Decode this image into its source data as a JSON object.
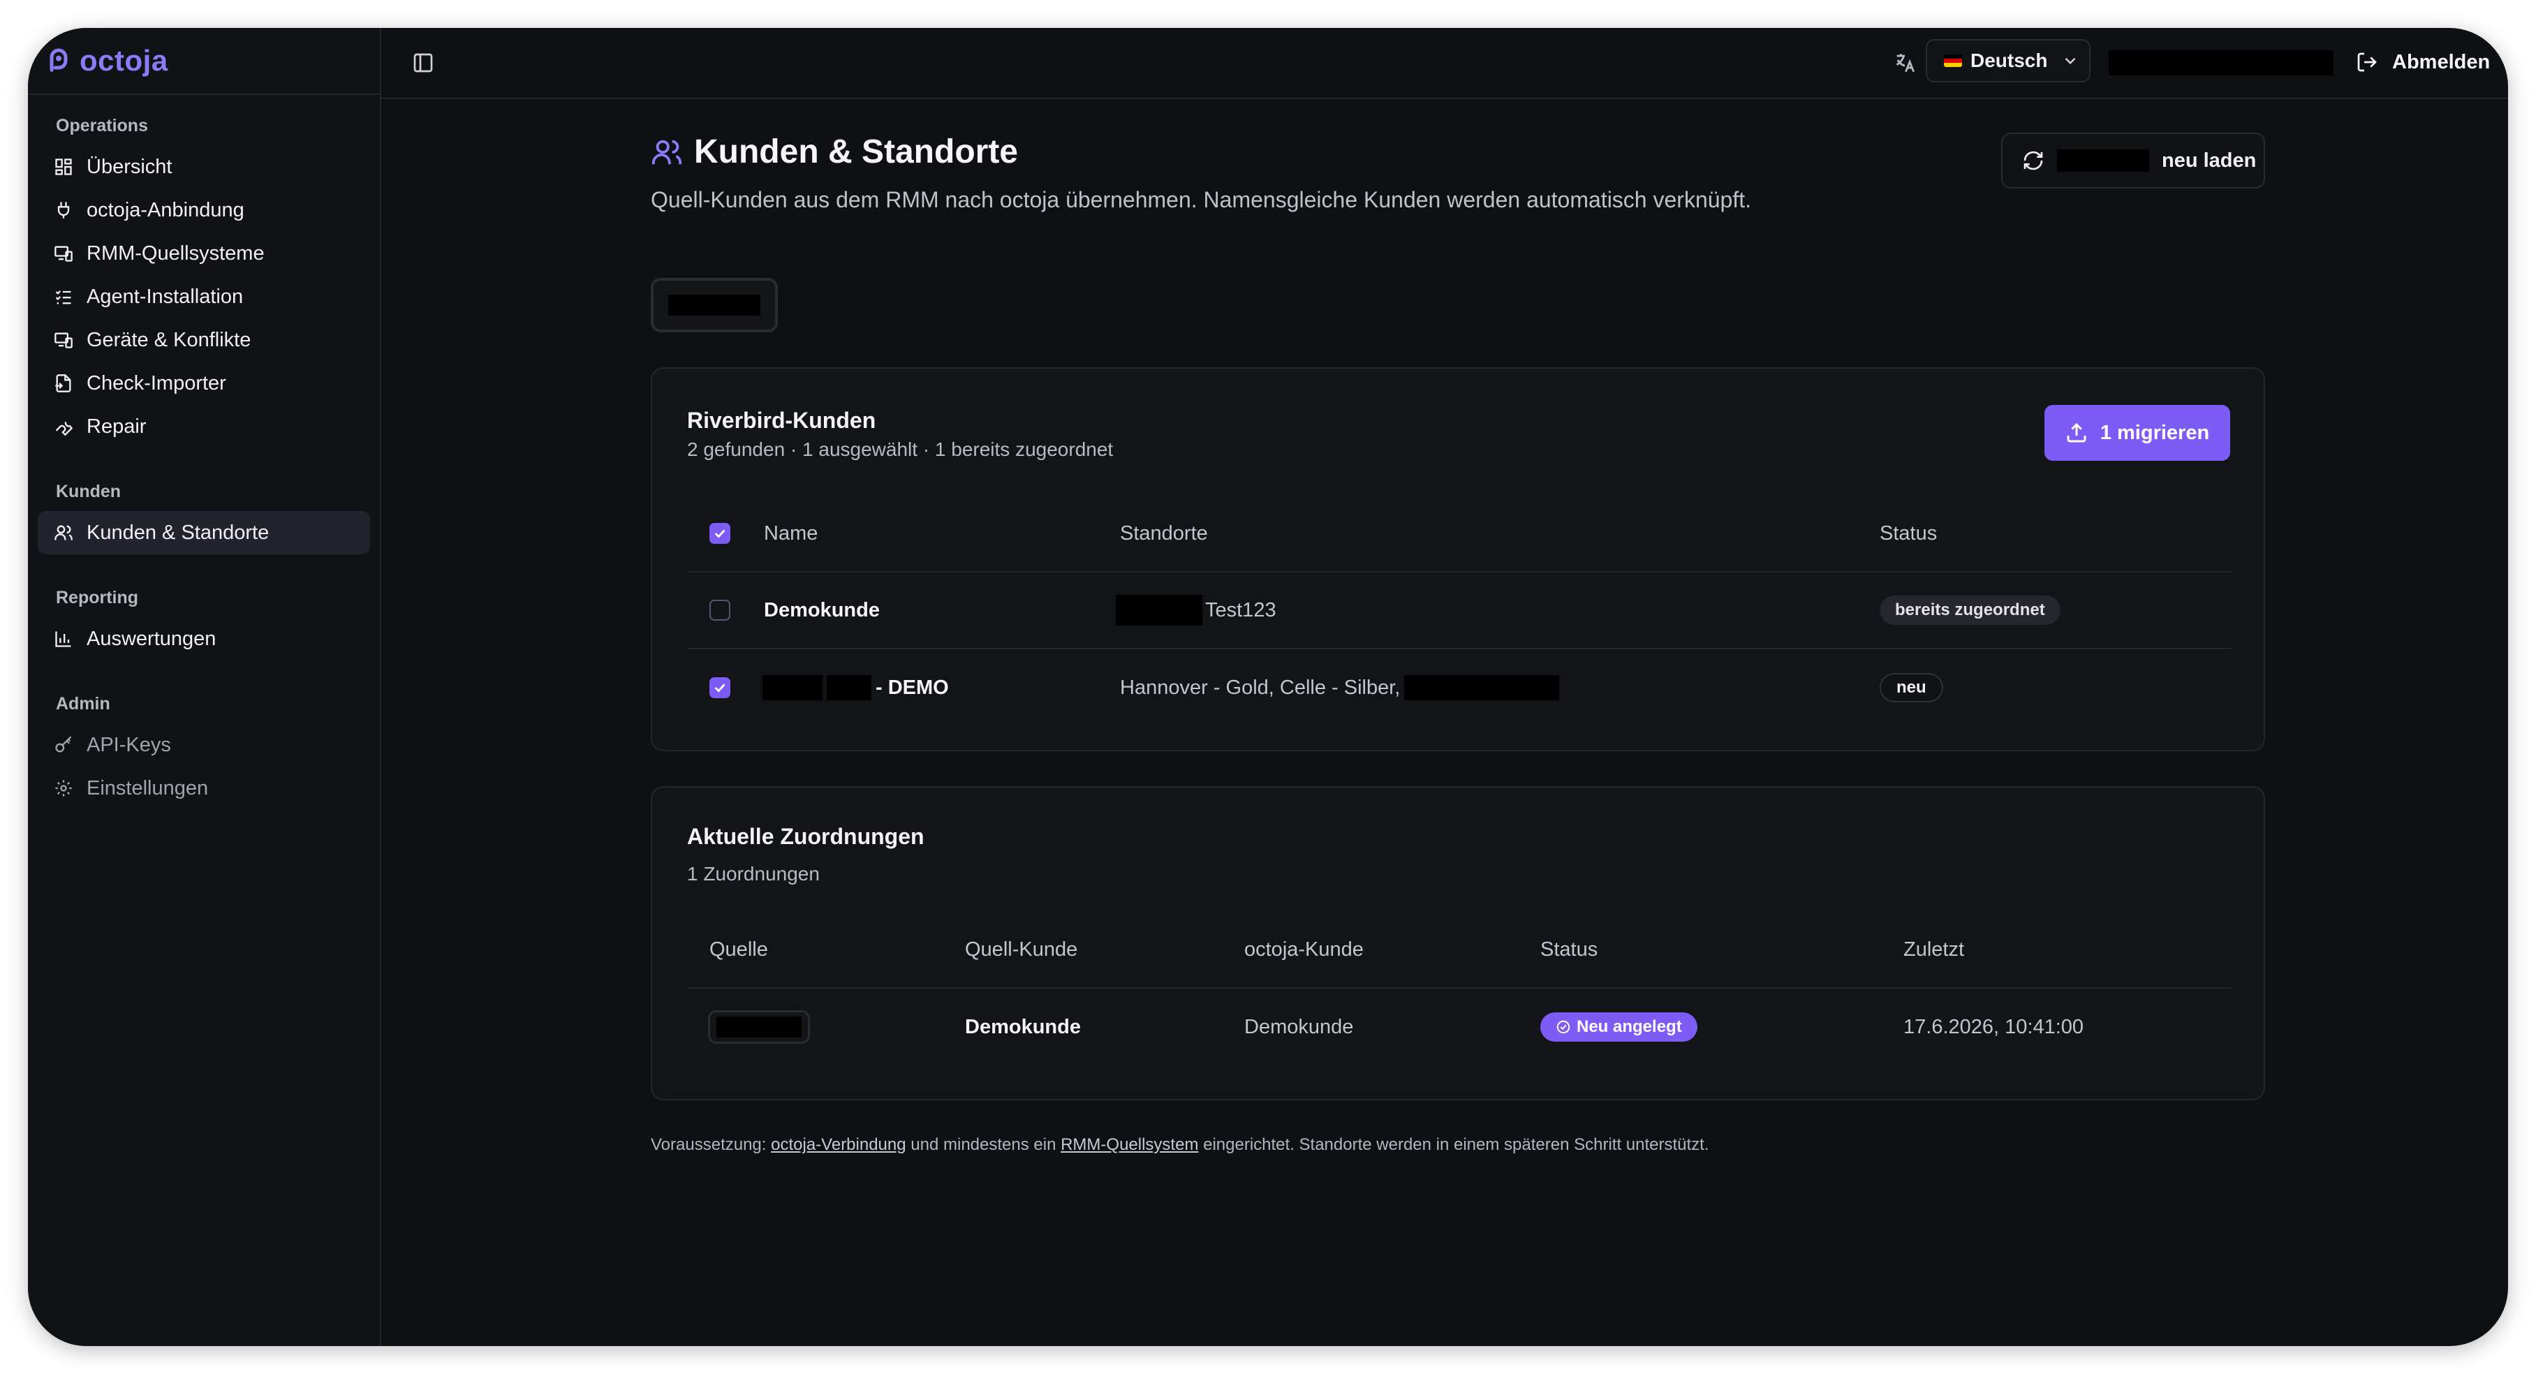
{
  "brand": {
    "name": "octoja"
  },
  "sidebar": {
    "sections": [
      {
        "label": "Operations",
        "items": [
          {
            "label": "Übersicht",
            "icon": "grid-icon"
          },
          {
            "label": "octoja-Anbindung",
            "icon": "plug-icon"
          },
          {
            "label": "RMM-Quellsysteme",
            "icon": "devices-icon"
          },
          {
            "label": "Agent-Installation",
            "icon": "list-check-icon"
          },
          {
            "label": "Geräte & Konflikte",
            "icon": "devices-icon"
          },
          {
            "label": "Check-Importer",
            "icon": "file-import-icon"
          },
          {
            "label": "Repair",
            "icon": "wrench-icon"
          }
        ]
      },
      {
        "label": "Kunden",
        "items": [
          {
            "label": "Kunden & Standorte",
            "icon": "users-icon",
            "active": true
          }
        ]
      },
      {
        "label": "Reporting",
        "items": [
          {
            "label": "Auswertungen",
            "icon": "bar-chart-icon"
          }
        ]
      },
      {
        "label": "Admin",
        "items": [
          {
            "label": "API-Keys",
            "icon": "key-icon",
            "muted": true
          },
          {
            "label": "Einstellungen",
            "icon": "gear-icon",
            "muted": true
          }
        ]
      }
    ]
  },
  "topbar": {
    "language": "Deutsch",
    "logout_label": "Abmelden"
  },
  "page": {
    "title": "Kunden & Standorte",
    "subtitle": "Quell-Kunden aus dem RMM nach octoja übernehmen. Namensgleiche Kunden werden automatisch verknüpft.",
    "reload_label": "neu laden"
  },
  "source_card": {
    "title": "Riverbird-Kunden",
    "summary": "2 gefunden · 1 ausgewählt · 1 bereits zugeordnet",
    "migrate_label": "1 migrieren",
    "columns": [
      "Name",
      "Standorte",
      "Status"
    ],
    "rows": [
      {
        "checked": false,
        "name": "Demokunde",
        "locations": "Test123",
        "status": "bereits zugeordnet"
      },
      {
        "checked": true,
        "name": "- DEMO",
        "locations": "Hannover - Gold, Celle - Silber,",
        "status": "neu"
      }
    ]
  },
  "mapping_card": {
    "title": "Aktuelle Zuordnungen",
    "summary": "1 Zuordnungen",
    "columns": [
      "Quelle",
      "Quell-Kunde",
      "octoja-Kunde",
      "Status",
      "Zuletzt"
    ],
    "rows": [
      {
        "source_customer": "Demokunde",
        "octoja_customer": "Demokunde",
        "status": "Neu angelegt",
        "last": "17.6.2026, 10:41:00"
      }
    ]
  },
  "footnote": {
    "prefix": "Voraussetzung:",
    "link1": "octoja-Verbindung",
    "middle": "und mindestens ein",
    "link2": "RMM-Quellsystem",
    "suffix": "eingerichtet. Standorte werden in einem späteren Schritt unterstützt."
  },
  "colors": {
    "accent": "#7c5cf4",
    "background": "#0f1013",
    "brand": "#8b7cf6"
  }
}
